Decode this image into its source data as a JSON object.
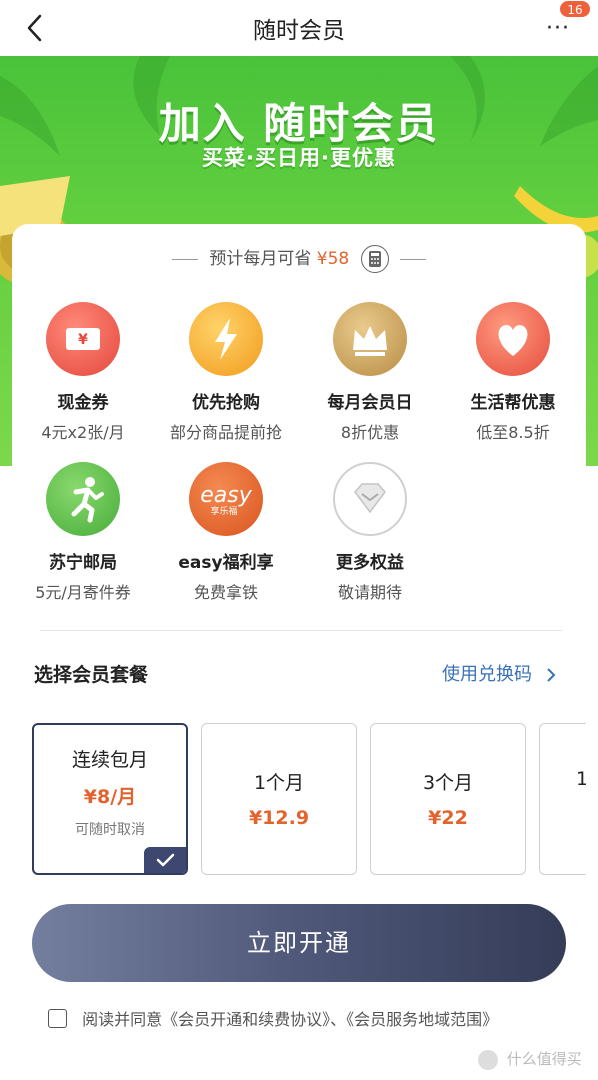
{
  "nav": {
    "title": "随时会员",
    "badge": "16",
    "more": "···"
  },
  "banner": {
    "title": "加入 随时会员",
    "subtitle": "买菜·买日用·更优惠"
  },
  "savings": {
    "label": "预计每月可省",
    "amount": "¥58"
  },
  "benefits": [
    {
      "title": "现金券",
      "desc": "4元x2张/月",
      "icon": "cash-coupon-icon",
      "color": "#ee5a4f",
      "glyph": "¥"
    },
    {
      "title": "优先抢购",
      "desc": "部分商品提前抢",
      "icon": "lightning-icon",
      "color": "#f5a623",
      "glyph": "⚡"
    },
    {
      "title": "每月会员日",
      "desc": "8折优惠",
      "icon": "crown-icon",
      "color": "#c8a05a",
      "glyph": "♛"
    },
    {
      "title": "生活帮优惠",
      "desc": "低至8.5折",
      "icon": "heart-icon",
      "color": "#f06450",
      "glyph": "♥"
    },
    {
      "title": "苏宁邮局",
      "desc": "5元/月寄件券",
      "icon": "runner-icon",
      "color": "#5cc04a",
      "glyph": "🏃"
    },
    {
      "title": "easy福利享",
      "desc": "免费拿铁",
      "icon": "easy-logo-icon",
      "color": "#e35f2a",
      "glyph": "easy",
      "sub_glyph": "享乐福"
    },
    {
      "title": "更多权益",
      "desc": "敬请期待",
      "icon": "diamond-icon",
      "color": "#bbbbbb",
      "glyph": "◇"
    }
  ],
  "plans_section": {
    "title": "选择会员套餐",
    "redeem": "使用兑换码"
  },
  "plans": [
    {
      "name": "连续包月",
      "price": "¥8/月",
      "note": "可随时取消",
      "selected": true
    },
    {
      "name": "1个月",
      "price": "¥12.9",
      "note": "",
      "selected": false
    },
    {
      "name": "3个月",
      "price": "¥22",
      "note": "",
      "selected": false
    },
    {
      "name": "1",
      "price": "",
      "note": "",
      "selected": false
    }
  ],
  "cta": {
    "label": "立即开通"
  },
  "agreement": {
    "text": "阅读并同意《会员开通和续费协议》、《会员服务地域范围》"
  },
  "watermark": {
    "text": "什么值得买"
  },
  "colors": {
    "accent_orange": "#e3632d",
    "link_blue": "#3a72b8",
    "button_dark": "#343c58",
    "banner_green": "#55c83d"
  }
}
